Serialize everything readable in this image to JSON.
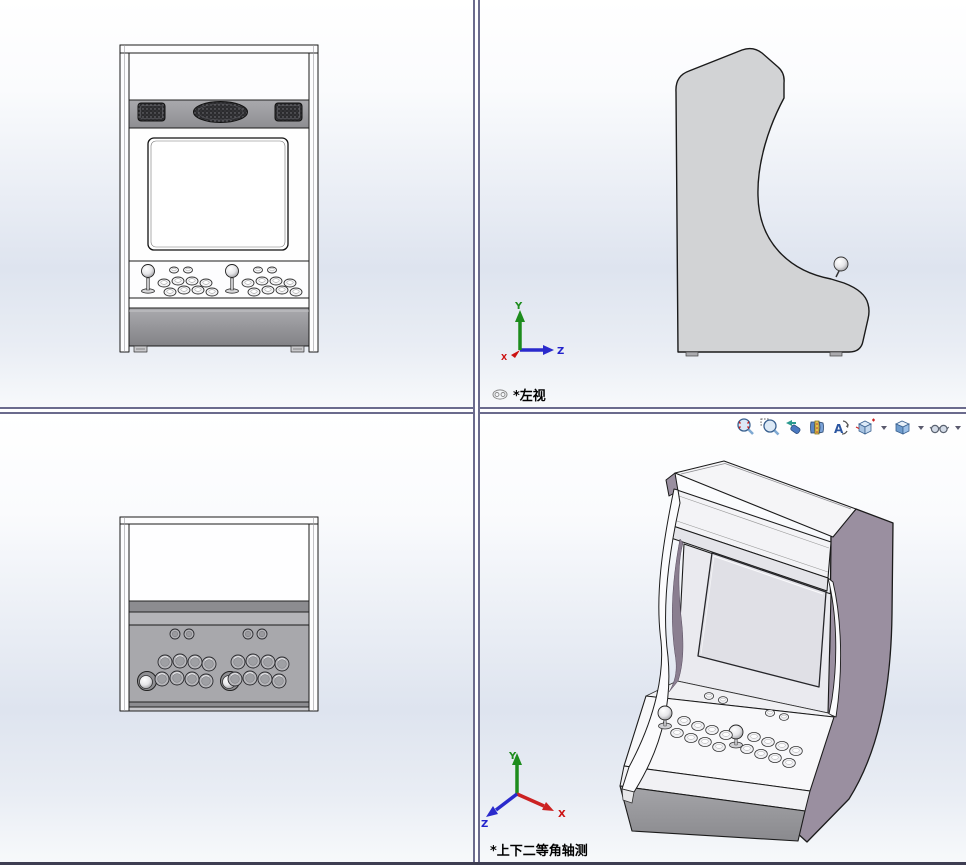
{
  "viewports": {
    "front": {
      "name": "front-view"
    },
    "side": {
      "name": "side-view",
      "label": "*左视"
    },
    "top": {
      "name": "top-view"
    },
    "isometric": {
      "name": "isometric-view",
      "label": "*上下二等角轴测"
    }
  },
  "axis_triad": {
    "x_label": "X",
    "y_label": "Y",
    "z_label": "Z",
    "x_color": "#cc1111",
    "y_color": "#1d8c1d",
    "z_color": "#2222cc"
  },
  "hud_toolbar": {
    "icons": [
      {
        "name": "zoom-to-fit"
      },
      {
        "name": "zoom-to-area"
      },
      {
        "name": "previous-view"
      },
      {
        "name": "section-view"
      },
      {
        "name": "dynamic-annotation-views"
      },
      {
        "name": "view-orientation",
        "has_dropdown": true
      },
      {
        "name": "display-style",
        "has_dropdown": true
      },
      {
        "name": "hide-show-items",
        "has_dropdown": true
      }
    ]
  },
  "model": {
    "colors": {
      "cabinet_side_purple": "#9a8fa0",
      "cabinet_front_white": "#fdfdfe",
      "panel_gray": "#a8a8ac",
      "side_profile_gray": "#d2d3d5",
      "base_gray": "#8e8e92"
    }
  }
}
